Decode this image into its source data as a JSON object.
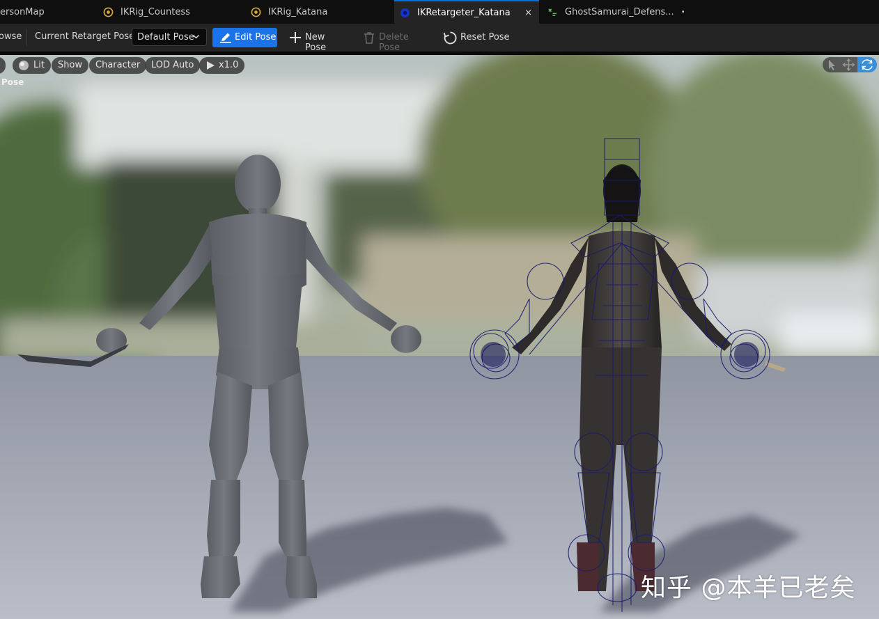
{
  "tabs": [
    {
      "label": "ersonMap",
      "icon": "map-icon"
    },
    {
      "label": "IKRig_Countess",
      "icon": "ik-rig-icon"
    },
    {
      "label": "IKRig_Katana",
      "icon": "ik-rig-icon"
    },
    {
      "label": "IKRetargeter_Katana",
      "icon": "ik-retargeter-icon",
      "active": true,
      "close": "×"
    },
    {
      "label": "GhostSamurai_Defens...",
      "icon": "blueprint-icon",
      "modified_marker": "•"
    }
  ],
  "toolbar": {
    "browse_label": "owse",
    "retarget_pose_label": "Current Retarget Pose:",
    "pose_dropdown_value": "Default Pose",
    "edit_pose_label": "Edit Pose",
    "new_pose_label": "New Pose",
    "delete_pose_label": "Delete Pose",
    "reset_pose_label": "Reset Pose"
  },
  "viewport": {
    "pills": {
      "lit": "Lit",
      "show": "Show",
      "character": "Character",
      "lod": "LOD Auto",
      "speed": "x1.0"
    },
    "mode_label": "Pose",
    "watermark": "知乎 @本羊已老矣"
  },
  "colors": {
    "accent_blue": "#1a73e8",
    "active_tab_border": "#0070e0",
    "bone_wire": "#1a1a6e",
    "floor": "#9ea3ad"
  }
}
